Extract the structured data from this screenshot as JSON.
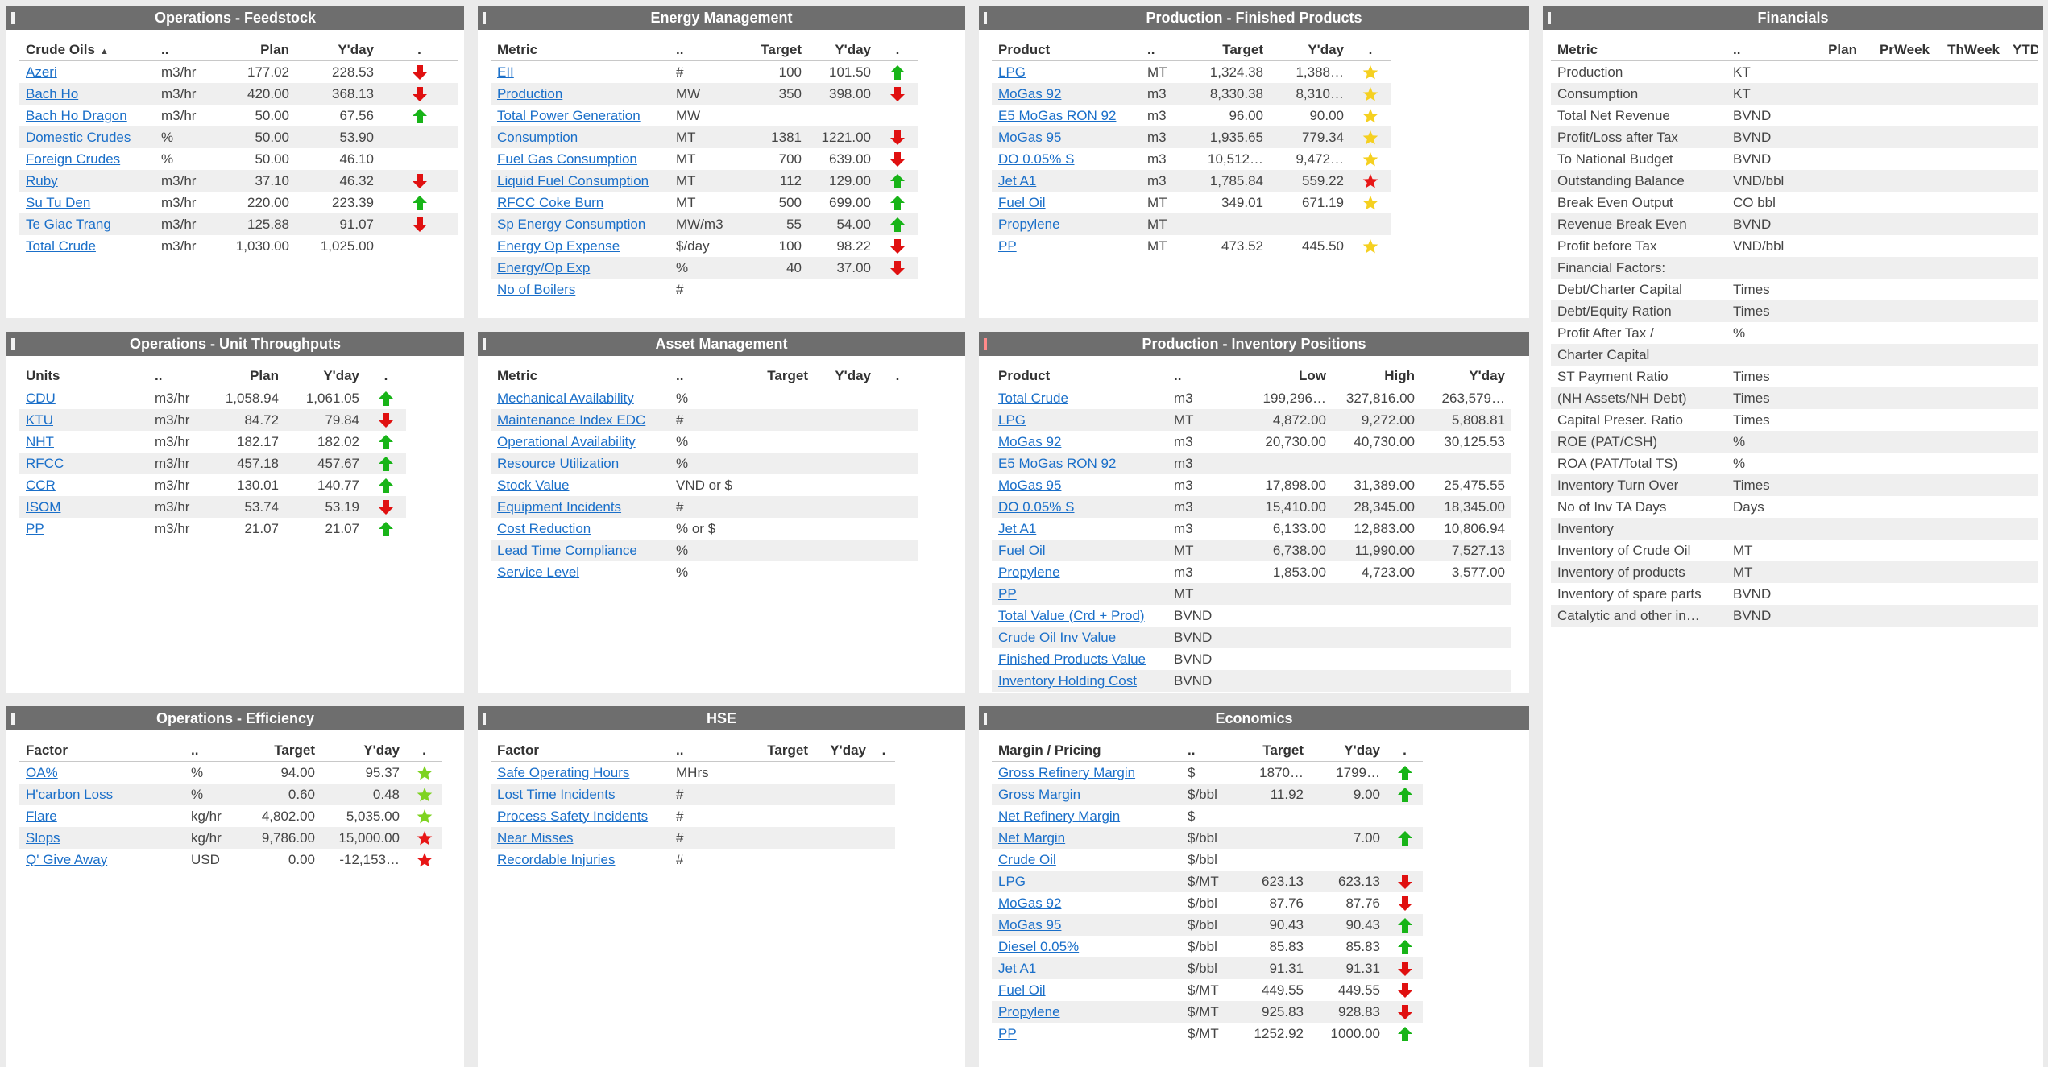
{
  "panels": [
    {
      "title": "Operations - Feedstock",
      "columns": [
        "Crude Oils",
        "..",
        "Plan",
        "Y'day",
        "."
      ],
      "rows": [
        {
          "name": "Azeri",
          "unit": "m3/hr",
          "a": "177.02",
          "b": "228.53",
          "ind": "down"
        },
        {
          "name": "Bach Ho",
          "unit": "m3/hr",
          "a": "420.00",
          "b": "368.13",
          "ind": "down"
        },
        {
          "name": "Bach Ho Dragon",
          "unit": "m3/hr",
          "a": "50.00",
          "b": "67.56",
          "ind": "up"
        },
        {
          "name": "Domestic Crudes",
          "unit": "%",
          "a": "50.00",
          "b": "53.90",
          "ind": ""
        },
        {
          "name": "Foreign Crudes",
          "unit": "%",
          "a": "50.00",
          "b": "46.10",
          "ind": ""
        },
        {
          "name": "Ruby",
          "unit": "m3/hr",
          "a": "37.10",
          "b": "46.32",
          "ind": "down"
        },
        {
          "name": "Su Tu Den",
          "unit": "m3/hr",
          "a": "220.00",
          "b": "223.39",
          "ind": "up"
        },
        {
          "name": "Te Giac Trang",
          "unit": "m3/hr",
          "a": "125.88",
          "b": "91.07",
          "ind": "down"
        },
        {
          "name": "Total Crude",
          "unit": "m3/hr",
          "a": "1,030.00",
          "b": "1,025.00",
          "ind": ""
        }
      ]
    },
    {
      "title": "Energy Management",
      "columns": [
        "Metric",
        "..",
        "Target",
        "Y'day",
        "."
      ],
      "rows": [
        {
          "name": "EII",
          "unit": "#",
          "a": "100",
          "b": "101.50",
          "ind": "up"
        },
        {
          "name": "Production",
          "unit": "MW",
          "a": "350",
          "b": "398.00",
          "ind": "down"
        },
        {
          "name": "Total Power Generation",
          "unit": "MW",
          "a": "",
          "b": "",
          "ind": ""
        },
        {
          "name": "Consumption",
          "unit": "MT",
          "a": "1381",
          "b": "1221.00",
          "ind": "down"
        },
        {
          "name": "Fuel Gas Consumption",
          "unit": "MT",
          "a": "700",
          "b": "639.00",
          "ind": "down"
        },
        {
          "name": "Liquid Fuel Consumption",
          "unit": "MT",
          "a": "112",
          "b": "129.00",
          "ind": "up"
        },
        {
          "name": "RFCC Coke Burn",
          "unit": "MT",
          "a": "500",
          "b": "699.00",
          "ind": "up"
        },
        {
          "name": "Sp Energy Consumption",
          "unit": "MW/m3",
          "a": "55",
          "b": "54.00",
          "ind": "up"
        },
        {
          "name": "Energy Op Expense",
          "unit": "$/day",
          "a": "100",
          "b": "98.22",
          "ind": "down"
        },
        {
          "name": "Energy/Op Exp",
          "unit": "%",
          "a": "40",
          "b": "37.00",
          "ind": "down"
        },
        {
          "name": "No of Boilers",
          "unit": "#",
          "a": "",
          "b": "",
          "ind": ""
        }
      ]
    },
    {
      "title": "Production - Finished Products",
      "columns": [
        "Product",
        "..",
        "Target",
        "Y'day",
        "."
      ],
      "rows": [
        {
          "name": "LPG",
          "unit": "MT",
          "a": "1,324.38",
          "b": "1,388…",
          "ind": "star-yellow"
        },
        {
          "name": "MoGas 92",
          "unit": "m3",
          "a": "8,330.38",
          "b": "8,310…",
          "ind": "star-yellow"
        },
        {
          "name": "E5 MoGas RON 92",
          "unit": "m3",
          "a": "96.00",
          "b": "90.00",
          "ind": "star-yellow"
        },
        {
          "name": "MoGas 95",
          "unit": "m3",
          "a": "1,935.65",
          "b": "779.34",
          "ind": "star-yellow"
        },
        {
          "name": "DO 0.05% S",
          "unit": "m3",
          "a": "10,512…",
          "b": "9,472…",
          "ind": "star-yellow"
        },
        {
          "name": "Jet A1",
          "unit": "m3",
          "a": "1,785.84",
          "b": "559.22",
          "ind": "star-red"
        },
        {
          "name": "Fuel Oil",
          "unit": "MT",
          "a": "349.01",
          "b": "671.19",
          "ind": "star-yellow"
        },
        {
          "name": "Propylene",
          "unit": "MT",
          "a": "",
          "b": "",
          "ind": ""
        },
        {
          "name": "PP",
          "unit": "MT",
          "a": "473.52",
          "b": "445.50",
          "ind": "star-yellow"
        }
      ]
    },
    {
      "title": "Financials",
      "columns": [
        "Metric",
        "..",
        "Plan",
        "PrWeek",
        "ThWeek",
        "YTD"
      ],
      "rows": [
        {
          "name": "Production",
          "unit": "KT"
        },
        {
          "name": "Consumption",
          "unit": "KT"
        },
        {
          "name": "Total Net Revenue",
          "unit": "BVND"
        },
        {
          "name": "Profit/Loss after Tax",
          "unit": "BVND"
        },
        {
          "name": "To National Budget",
          "unit": "BVND"
        },
        {
          "name": "Outstanding Balance",
          "unit": "VND/bbl"
        },
        {
          "name": "Break Even Output",
          "unit": "CO bbl"
        },
        {
          "name": "Revenue Break Even",
          "unit": "BVND"
        },
        {
          "name": "Profit before Tax",
          "unit": "VND/bbl"
        },
        {
          "name": "Financial Factors:",
          "unit": ""
        },
        {
          "name": "Debt/Charter Capital",
          "unit": "Times"
        },
        {
          "name": "Debt/Equity Ration",
          "unit": "Times"
        },
        {
          "name": "Profit After Tax /",
          "unit": "%"
        },
        {
          "name": "Charter Capital",
          "unit": ""
        },
        {
          "name": "ST Payment Ratio",
          "unit": "Times"
        },
        {
          "name": "(NH Assets/NH Debt)",
          "unit": "Times"
        },
        {
          "name": "Capital Preser. Ratio",
          "unit": "Times"
        },
        {
          "name": "ROE (PAT/CSH)",
          "unit": "%"
        },
        {
          "name": "ROA (PAT/Total TS)",
          "unit": "%"
        },
        {
          "name": "Inventory Turn Over",
          "unit": "Times"
        },
        {
          "name": "No of Inv TA Days",
          "unit": "Days"
        },
        {
          "name": "Inventory",
          "unit": ""
        },
        {
          "name": "Inventory of Crude Oil",
          "unit": "MT"
        },
        {
          "name": "Inventory of products",
          "unit": "MT"
        },
        {
          "name": "Inventory of spare parts",
          "unit": "BVND"
        },
        {
          "name": "Catalytic and other in…",
          "unit": "BVND"
        }
      ]
    },
    {
      "title": "Operations - Unit Throughputs",
      "columns": [
        "Units",
        "..",
        "Plan",
        "Y'day",
        "."
      ],
      "rows": [
        {
          "name": "CDU",
          "unit": "m3/hr",
          "a": "1,058.94",
          "b": "1,061.05",
          "ind": "up"
        },
        {
          "name": "KTU",
          "unit": "m3/hr",
          "a": "84.72",
          "b": "79.84",
          "ind": "down"
        },
        {
          "name": "NHT",
          "unit": "m3/hr",
          "a": "182.17",
          "b": "182.02",
          "ind": "up"
        },
        {
          "name": "RFCC",
          "unit": "m3/hr",
          "a": "457.18",
          "b": "457.67",
          "ind": "up"
        },
        {
          "name": "CCR",
          "unit": "m3/hr",
          "a": "130.01",
          "b": "140.77",
          "ind": "up"
        },
        {
          "name": "ISOM",
          "unit": "m3/hr",
          "a": "53.74",
          "b": "53.19",
          "ind": "down"
        },
        {
          "name": "PP",
          "unit": "m3/hr",
          "a": "21.07",
          "b": "21.07",
          "ind": "up"
        }
      ]
    },
    {
      "title": "Asset Management",
      "columns": [
        "Metric",
        "..",
        "Target",
        "Y'day",
        "."
      ],
      "rows": [
        {
          "name": "Mechanical Availability",
          "unit": "%",
          "a": "",
          "b": "",
          "ind": ""
        },
        {
          "name": "Maintenance Index EDC",
          "unit": "#",
          "a": "",
          "b": "",
          "ind": ""
        },
        {
          "name": "Operational Availability",
          "unit": "%",
          "a": "",
          "b": "",
          "ind": ""
        },
        {
          "name": "Resource Utilization",
          "unit": "%",
          "a": "",
          "b": "",
          "ind": ""
        },
        {
          "name": "Stock Value",
          "unit": "VND or $",
          "a": "",
          "b": "",
          "ind": ""
        },
        {
          "name": "Equipment Incidents",
          "unit": "#",
          "a": "",
          "b": "",
          "ind": ""
        },
        {
          "name": "Cost Reduction",
          "unit": "% or $",
          "a": "",
          "b": "",
          "ind": ""
        },
        {
          "name": "Lead Time Compliance",
          "unit": "%",
          "a": "",
          "b": "",
          "ind": ""
        },
        {
          "name": "Service Level",
          "unit": "%",
          "a": "",
          "b": "",
          "ind": ""
        }
      ]
    },
    {
      "title": "Production - Inventory Positions",
      "columns": [
        "Product",
        "..",
        "Low",
        "High",
        "Y'day"
      ],
      "rows": [
        {
          "name": "Total Crude",
          "unit": "m3",
          "a": "199,296…",
          "b": "327,816.00",
          "c": "263,579…"
        },
        {
          "name": "LPG",
          "unit": "MT",
          "a": "4,872.00",
          "b": "9,272.00",
          "c": "5,808.81"
        },
        {
          "name": "MoGas 92",
          "unit": "m3",
          "a": "20,730.00",
          "b": "40,730.00",
          "c": "30,125.53"
        },
        {
          "name": "E5 MoGas RON 92",
          "unit": "m3",
          "a": "",
          "b": "",
          "c": ""
        },
        {
          "name": "MoGas 95",
          "unit": "m3",
          "a": "17,898.00",
          "b": "31,389.00",
          "c": "25,475.55"
        },
        {
          "name": "DO 0.05% S",
          "unit": "m3",
          "a": "15,410.00",
          "b": "28,345.00",
          "c": "18,345.00"
        },
        {
          "name": "Jet A1",
          "unit": "m3",
          "a": "6,133.00",
          "b": "12,883.00",
          "c": "10,806.94"
        },
        {
          "name": "Fuel Oil",
          "unit": "MT",
          "a": "6,738.00",
          "b": "11,990.00",
          "c": "7,527.13"
        },
        {
          "name": "Propylene",
          "unit": "m3",
          "a": "1,853.00",
          "b": "4,723.00",
          "c": "3,577.00"
        },
        {
          "name": "PP",
          "unit": "MT",
          "a": "",
          "b": "",
          "c": ""
        },
        {
          "name": "Total Value (Crd + Prod)",
          "unit": "BVND",
          "a": "",
          "b": "",
          "c": ""
        },
        {
          "name": "Crude Oil Inv Value",
          "unit": "BVND",
          "a": "",
          "b": "",
          "c": ""
        },
        {
          "name": "Finished Products Value",
          "unit": "BVND",
          "a": "",
          "b": "",
          "c": ""
        },
        {
          "name": "Inventory Holding Cost",
          "unit": "BVND",
          "a": "",
          "b": "",
          "c": ""
        }
      ]
    },
    {
      "title": "Operations - Efficiency",
      "columns": [
        "Factor",
        "..",
        "Target",
        "Y'day",
        "."
      ],
      "rows": [
        {
          "name": "OA%",
          "unit": "%",
          "a": "94.00",
          "b": "95.37",
          "ind": "star-green"
        },
        {
          "name": "H'carbon Loss",
          "unit": "%",
          "a": "0.60",
          "b": "0.48",
          "ind": "star-green"
        },
        {
          "name": "Flare",
          "unit": "kg/hr",
          "a": "4,802.00",
          "b": "5,035.00",
          "ind": "star-green"
        },
        {
          "name": "Slops",
          "unit": "kg/hr",
          "a": "9,786.00",
          "b": "15,000.00",
          "ind": "star-red"
        },
        {
          "name": "Q' Give Away",
          "unit": "USD",
          "a": "0.00",
          "b": "-12,153…",
          "ind": "star-red"
        }
      ]
    },
    {
      "title": "HSE",
      "columns": [
        "Factor",
        "..",
        "Target",
        "Y'day",
        "."
      ],
      "rows": [
        {
          "name": "Safe Operating Hours",
          "unit": "MHrs",
          "a": "",
          "b": "",
          "ind": ""
        },
        {
          "name": "Lost Time Incidents",
          "unit": "#",
          "a": "",
          "b": "",
          "ind": ""
        },
        {
          "name": "Process Safety Incidents",
          "unit": "#",
          "a": "",
          "b": "",
          "ind": ""
        },
        {
          "name": "Near Misses",
          "unit": "#",
          "a": "",
          "b": "",
          "ind": ""
        },
        {
          "name": "Recordable Injuries",
          "unit": "#",
          "a": "",
          "b": "",
          "ind": ""
        }
      ]
    },
    {
      "title": "Economics",
      "columns": [
        "Margin / Pricing",
        "..",
        "Target",
        "Y'day",
        "."
      ],
      "rows": [
        {
          "name": "Gross Refinery Margin",
          "unit": "$",
          "a": "1870…",
          "b": "1799…",
          "ind": "up"
        },
        {
          "name": "Gross Margin",
          "unit": "$/bbl",
          "a": "11.92",
          "b": "9.00",
          "ind": "up"
        },
        {
          "name": "Net Refinery Margin",
          "unit": "$",
          "a": "",
          "b": "",
          "ind": ""
        },
        {
          "name": "Net Margin",
          "unit": "$/bbl",
          "a": "",
          "b": "7.00",
          "ind": "up"
        },
        {
          "name": "Crude Oil",
          "unit": "$/bbl",
          "a": "",
          "b": "",
          "ind": ""
        },
        {
          "name": "LPG",
          "unit": "$/MT",
          "a": "623.13",
          "b": "623.13",
          "ind": "down"
        },
        {
          "name": "MoGas 92",
          "unit": "$/bbl",
          "a": "87.76",
          "b": "87.76",
          "ind": "down"
        },
        {
          "name": "MoGas 95",
          "unit": "$/bbl",
          "a": "90.43",
          "b": "90.43",
          "ind": "up"
        },
        {
          "name": "Diesel 0.05%",
          "unit": "$/bbl",
          "a": "85.83",
          "b": "85.83",
          "ind": "up"
        },
        {
          "name": "Jet A1",
          "unit": "$/bbl",
          "a": "91.31",
          "b": "91.31",
          "ind": "down"
        },
        {
          "name": "Fuel Oil",
          "unit": "$/MT",
          "a": "449.55",
          "b": "449.55",
          "ind": "down"
        },
        {
          "name": "Propylene",
          "unit": "$/MT",
          "a": "925.83",
          "b": "928.83",
          "ind": "down"
        },
        {
          "name": "PP",
          "unit": "$/MT",
          "a": "1252.92",
          "b": "1000.00",
          "ind": "up"
        }
      ]
    }
  ],
  "colors": {
    "header": "#6e6e6e",
    "link": "#1a6fc9",
    "up": "#18b418",
    "down": "#e01010",
    "star_yellow": "#f5d020",
    "star_green": "#7ed321",
    "star_red": "#e81616"
  }
}
